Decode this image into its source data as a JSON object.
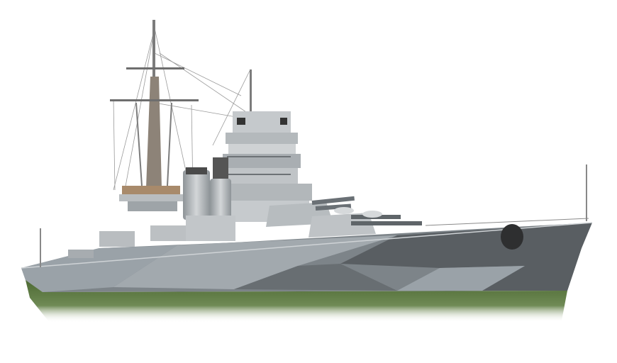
{
  "image": {
    "subject": "warship",
    "background_color": "#ffffff",
    "palette": {
      "hull_dark": "#595e62",
      "hull_light": "#9aa2a8",
      "hull_mid": "#7d8489",
      "superstructure": "#c5c9cc",
      "superstructure_shadow": "#9ea4a8",
      "waterline_green": "#5b7a3c",
      "mast": "#8d8378",
      "deck_brown": "#a88a6b"
    }
  }
}
